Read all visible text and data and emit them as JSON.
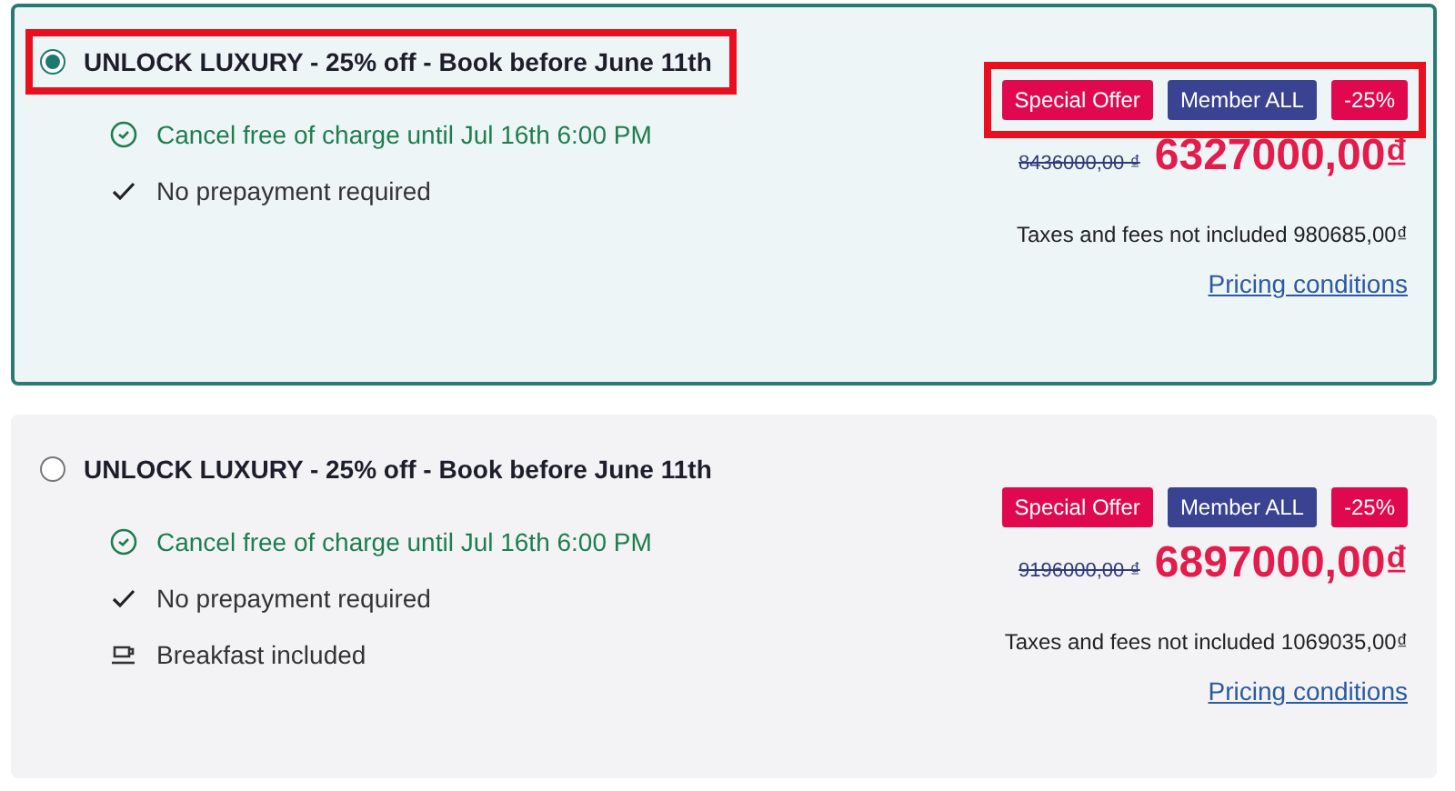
{
  "offers": [
    {
      "title": "UNLOCK LUXURY - 25% off - Book before June 11th",
      "selected": true,
      "highlighted": true,
      "features": [
        {
          "kind": "cancel",
          "text": "Cancel free of charge until Jul 16th 6:00 PM"
        },
        {
          "kind": "check",
          "text": "No prepayment required"
        }
      ],
      "badges": [
        {
          "text": "Special Offer",
          "color": "#e0094f"
        },
        {
          "text": "Member ALL",
          "color": "#3a4392"
        },
        {
          "text": "-25%",
          "color": "#e0094f"
        }
      ],
      "old_price": "8436000,00 ₫",
      "price": "6327000,00₫",
      "taxes": "Taxes and fees not included 980685,00₫",
      "link": "Pricing conditions"
    },
    {
      "title": "UNLOCK LUXURY - 25% off - Book before June 11th",
      "selected": false,
      "highlighted": false,
      "features": [
        {
          "kind": "cancel",
          "text": "Cancel free of charge until Jul 16th 6:00 PM"
        },
        {
          "kind": "check",
          "text": "No prepayment required"
        },
        {
          "kind": "breakfast",
          "text": "Breakfast included"
        }
      ],
      "badges": [
        {
          "text": "Special Offer",
          "color": "#e0094f"
        },
        {
          "text": "Member ALL",
          "color": "#3a4392"
        },
        {
          "text": "-25%",
          "color": "#e0094f"
        }
      ],
      "old_price": "9196000,00 ₫",
      "price": "6897000,00₫",
      "taxes": "Taxes and fees not included 1069035,00₫",
      "link": "Pricing conditions"
    }
  ]
}
